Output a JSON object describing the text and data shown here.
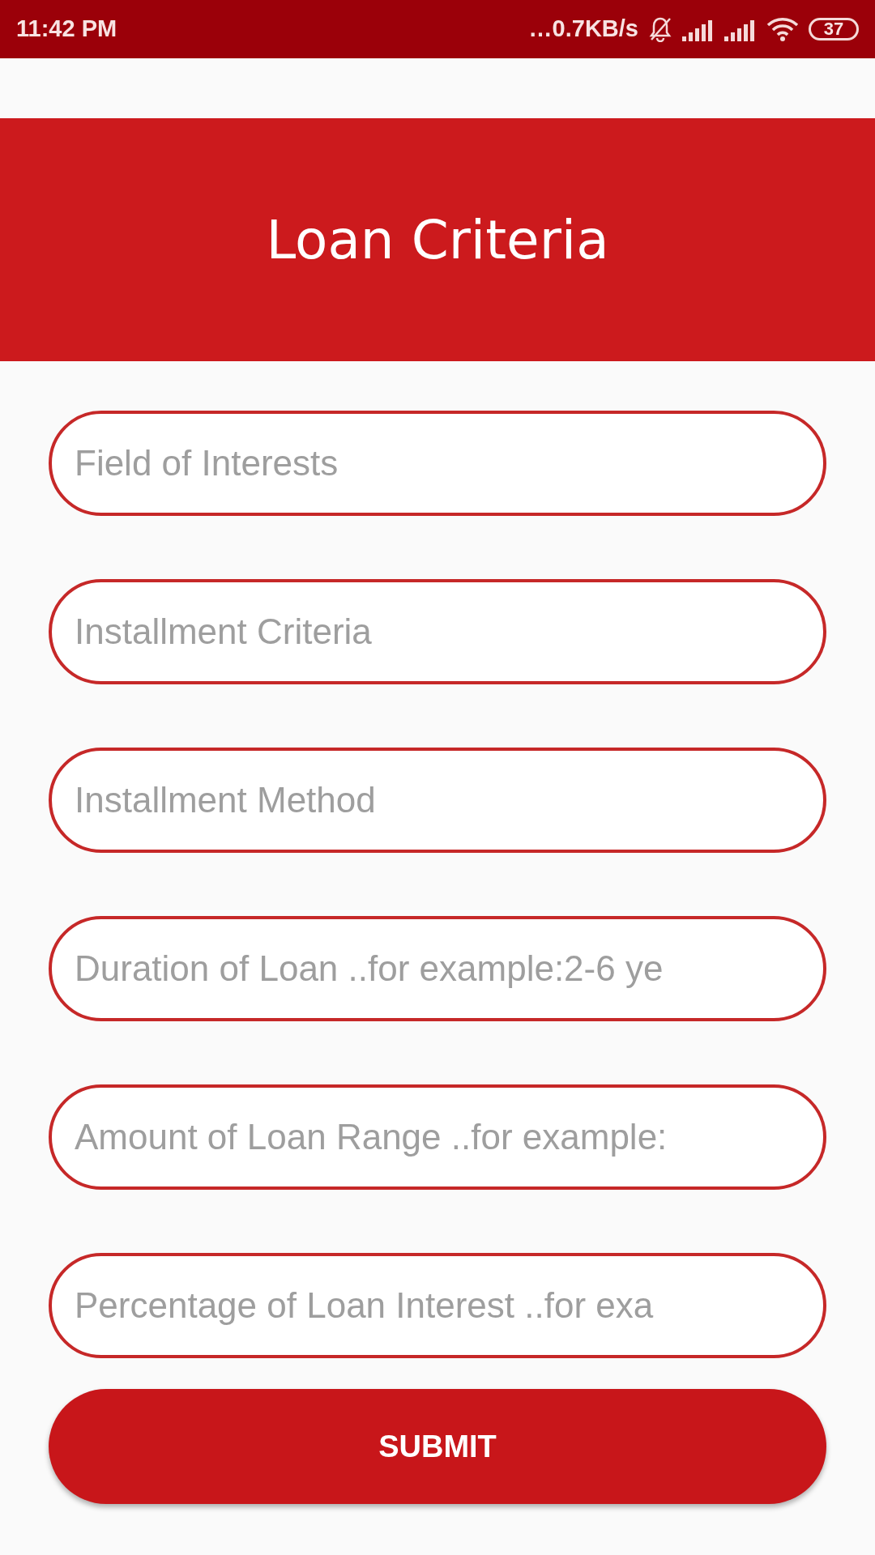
{
  "status_bar": {
    "time": "11:42 PM",
    "network_speed": "…0.7KB/s",
    "battery": "37"
  },
  "header": {
    "title": "Loan Criteria"
  },
  "fields": [
    {
      "placeholder": "Field of Interests"
    },
    {
      "placeholder": "Installment Criteria"
    },
    {
      "placeholder": "Installment Method"
    },
    {
      "placeholder": "Duration of Loan ..for example:2-6 ye"
    },
    {
      "placeholder": "Amount of Loan Range ..for example:"
    },
    {
      "placeholder": "Percentage of Loan Interest ..for exa"
    }
  ],
  "submit_button": {
    "label": "SUBMIT"
  }
}
